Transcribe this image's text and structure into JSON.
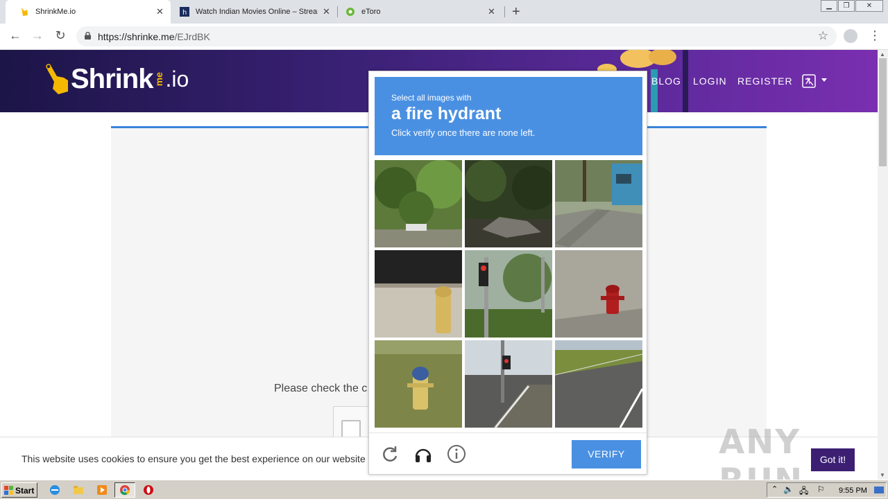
{
  "browser": {
    "tabs": [
      {
        "title": "ShrinkMe.io",
        "active": true
      },
      {
        "title": "Watch Indian Movies Online – Strean",
        "active": false
      },
      {
        "title": "eToro",
        "active": false
      }
    ],
    "url_host": "https://shrinke.me",
    "url_path": "/EJrdBK"
  },
  "site": {
    "logo_text": "Shrink",
    "logo_me": "me",
    "logo_io": ".io",
    "nav": [
      "BLOG",
      "LOGIN",
      "REGISTER"
    ],
    "please_text": "Please check the c",
    "cookie_text": "This website uses cookies to ensure you get the best experience on our website",
    "got_it": "Got it!",
    "watermark": "ANY RUN"
  },
  "captcha": {
    "select_text": "Select all images with",
    "object": "a fire hydrant",
    "instruction": "Click verify once there are none left.",
    "verify_label": "VERIFY",
    "tiles": [
      "trees-road",
      "wrecked-car-trees",
      "truck-street",
      "yellow-hydrant-fence",
      "traffic-light-grass",
      "red-hydrant-sidewalk",
      "yellow-hydrant-grass",
      "intersection",
      "highway"
    ]
  },
  "taskbar": {
    "start_label": "Start",
    "clock": "9:55 PM"
  }
}
